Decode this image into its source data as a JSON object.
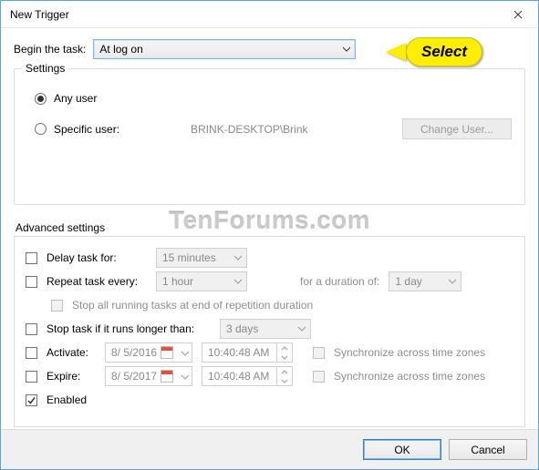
{
  "window": {
    "title": "New Trigger"
  },
  "callout": {
    "text": "Select"
  },
  "watermark": "TenForums.com",
  "begin": {
    "label": "Begin the task:",
    "value": "At log on"
  },
  "settings": {
    "legend": "Settings",
    "any_user_label": "Any user",
    "specific_user_label": "Specific user:",
    "specific_user_value": "BRINK-DESKTOP\\Brink",
    "change_user_btn": "Change User..."
  },
  "advanced": {
    "legend": "Advanced settings",
    "delay_label": "Delay task for:",
    "delay_value": "15 minutes",
    "repeat_label": "Repeat task every:",
    "repeat_value": "1 hour",
    "duration_label": "for a duration of:",
    "duration_value": "1 day",
    "stop_running_label": "Stop all running tasks at end of repetition duration",
    "stop_longer_label": "Stop task if it runs longer than:",
    "stop_longer_value": "3 days",
    "activate_label": "Activate:",
    "activate_date": "8/ 5/2016",
    "activate_time": "10:40:48 AM",
    "expire_label": "Expire:",
    "expire_date": "8/ 5/2017",
    "expire_time": "10:40:48 AM",
    "sync_label": "Synchronize across time zones",
    "enabled_label": "Enabled"
  },
  "footer": {
    "ok": "OK",
    "cancel": "Cancel"
  }
}
